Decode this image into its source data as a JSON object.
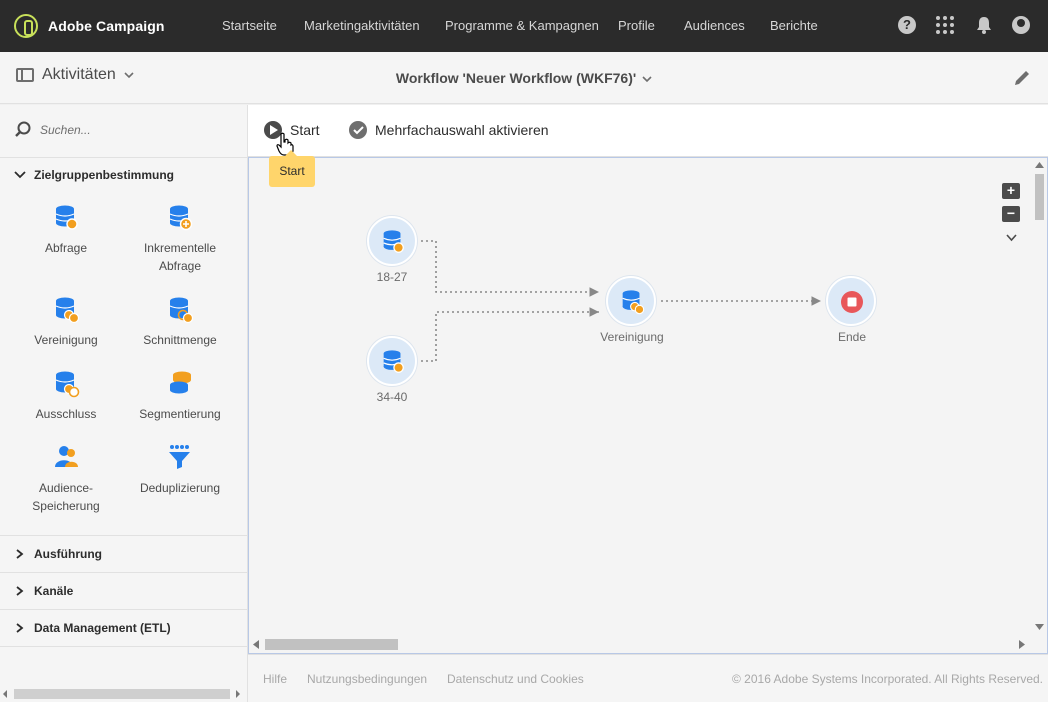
{
  "app": {
    "name": "Adobe Campaign"
  },
  "topnav": [
    "Startseite",
    "Marketingaktivitäten",
    "Programme & Kampagnen",
    "Profile",
    "Audiences",
    "Berichte"
  ],
  "topicons": {
    "help": "?",
    "apps": "apps-grid-icon",
    "bell": "bell-icon",
    "user": "user-avatar-icon"
  },
  "header": {
    "section": "Aktivitäten",
    "workflow_title": "Workflow 'Neuer Workflow (WKF76)'"
  },
  "sidebar": {
    "search_placeholder": "Suchen...",
    "sections": [
      {
        "label": "Zielgruppenbestimmung",
        "expanded": true
      },
      {
        "label": "Ausführung",
        "expanded": false
      },
      {
        "label": "Kanäle",
        "expanded": false
      },
      {
        "label": "Data Management (ETL)",
        "expanded": false
      }
    ],
    "activities": [
      {
        "label": "Abfrage",
        "icon": "query-icon"
      },
      {
        "label": "Inkrementelle Abfrage",
        "icon": "incremental-query-icon"
      },
      {
        "label": "Vereinigung",
        "icon": "union-icon"
      },
      {
        "label": "Schnittmenge",
        "icon": "intersection-icon"
      },
      {
        "label": "Ausschluss",
        "icon": "exclusion-icon"
      },
      {
        "label": "Segmentierung",
        "icon": "segmentation-icon"
      },
      {
        "label": "Audience-Speicherung",
        "icon": "save-audience-icon"
      },
      {
        "label": "Deduplizierung",
        "icon": "deduplication-icon"
      }
    ]
  },
  "toolbar": {
    "start_label": "Start",
    "multiselect_label": "Mehrfachauswahl aktivieren",
    "tooltip": "Start"
  },
  "canvas": {
    "nodes": [
      {
        "label": "18-27",
        "type": "query"
      },
      {
        "label": "34-40",
        "type": "query"
      },
      {
        "label": "Vereinigung",
        "type": "union"
      },
      {
        "label": "Ende",
        "type": "end"
      }
    ],
    "zoom_in": "+",
    "zoom_out": "−"
  },
  "footer": {
    "links": [
      "Hilfe",
      "Nutzungsbedingungen",
      "Datenschutz und Cookies"
    ],
    "copyright": "© 2016 Adobe Systems Incorporated. All Rights Reserved."
  },
  "colors": {
    "topbar": "#2b2b2b",
    "accent_blue": "#2680eb",
    "node_bg": "#dce9f7",
    "end_red": "#e8575a",
    "tooltip": "#ffd56b",
    "brand_green": "#c8e05a"
  }
}
